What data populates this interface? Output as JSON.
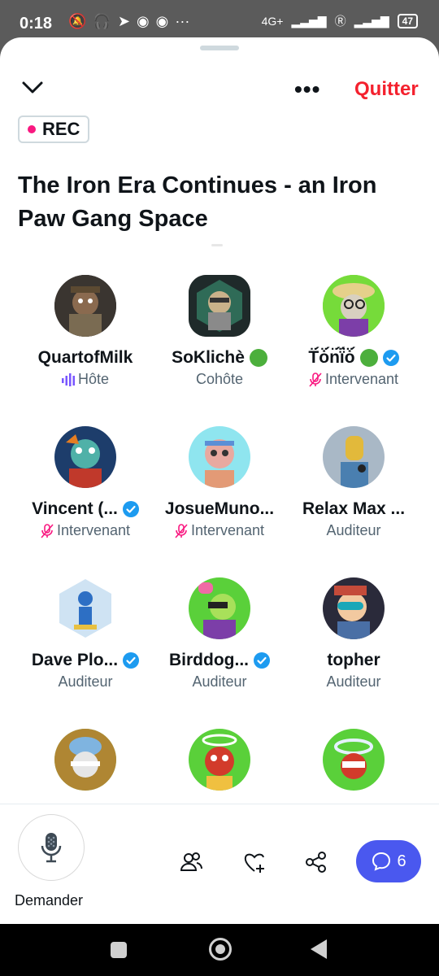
{
  "status": {
    "time": "0:18",
    "network": "4G+",
    "battery": "47"
  },
  "header": {
    "rec": "REC",
    "quit": "Quitter"
  },
  "space": {
    "title": "The Iron Era Continues - an Iron Paw Gang Space"
  },
  "people": [
    {
      "name": "QuartofMilk",
      "role": "Hôte",
      "badge": "",
      "icon": "speaking-bars-icon"
    },
    {
      "name": "SoKlichè",
      "role": "Cohôte",
      "badge": "green-circle",
      "icon": ""
    },
    {
      "name": "T̈́ȯ̈́n̈́ï̈́ȯ̈́",
      "role": "Intervenant",
      "badge": "green-circle verified",
      "icon": "mic-muted-icon"
    },
    {
      "name": "Vincent (...",
      "role": "Intervenant",
      "badge": "verified",
      "icon": "mic-muted-icon"
    },
    {
      "name": "JosueMuno...",
      "role": "Intervenant",
      "badge": "",
      "icon": "mic-muted-icon"
    },
    {
      "name": "Relax Max ...",
      "role": "Auditeur",
      "badge": "",
      "icon": ""
    },
    {
      "name": "Dave Plo...",
      "role": "Auditeur",
      "badge": "verified",
      "icon": ""
    },
    {
      "name": "Birddog...",
      "role": "Auditeur",
      "badge": "verified",
      "icon": ""
    },
    {
      "name": "topher",
      "role": "Auditeur",
      "badge": "",
      "icon": ""
    },
    {
      "name": "",
      "role": "",
      "badge": "",
      "icon": ""
    },
    {
      "name": "",
      "role": "",
      "badge": "",
      "icon": ""
    },
    {
      "name": "",
      "role": "",
      "badge": "",
      "icon": ""
    }
  ],
  "bottom": {
    "request_label": "Demander",
    "chat_count": "6"
  },
  "colors": {
    "accent": "#4a58ef",
    "quit": "#f4212e",
    "rec_dot": "#f91880",
    "verified": "#1d9bf0",
    "host_bars": "#7856ff",
    "muted_mic": "#f91880"
  }
}
